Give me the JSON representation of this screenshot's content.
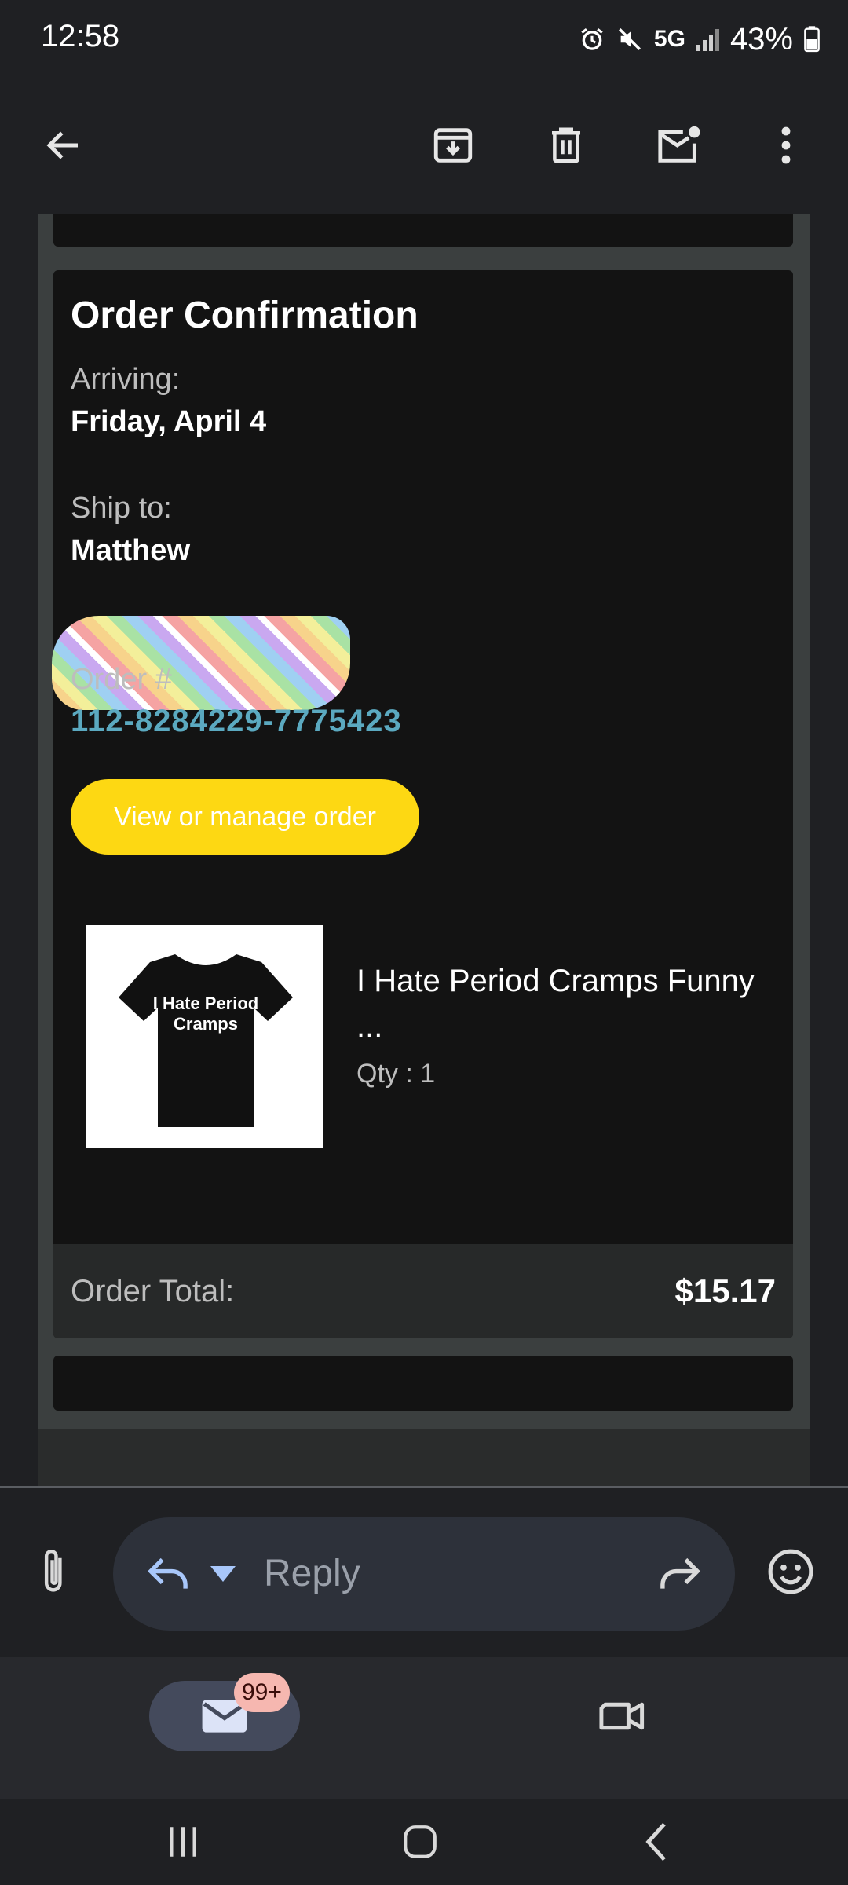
{
  "status_bar": {
    "time": "12:58",
    "network": "5G",
    "battery": "43%"
  },
  "toolbar": {
    "icons": [
      "back-arrow-icon",
      "archive-icon",
      "delete-icon",
      "mark-unread-icon",
      "more-icon"
    ]
  },
  "order": {
    "title": "Order Confirmation",
    "arriving_label": "Arriving:",
    "arriving_date": "Friday, April 4",
    "ship_to_label": "Ship to:",
    "ship_to_name": "Matthew",
    "order_number_label": "Order #",
    "order_number": "112-8284229-7775423",
    "manage_button": "View or manage order",
    "product": {
      "name": "I Hate Period Cramps Funny ...",
      "qty": "Qty : 1",
      "shirt_print": "I Hate Period Cramps"
    },
    "total_label": "Order Total:",
    "total_value": "$15.17"
  },
  "reply_bar": {
    "placeholder": "Reply"
  },
  "bottom_nav": {
    "badge": "99+"
  },
  "colors": {
    "accent_button": "#fdd813",
    "order_number": "#5ba9c0",
    "background": "#1f2023"
  }
}
